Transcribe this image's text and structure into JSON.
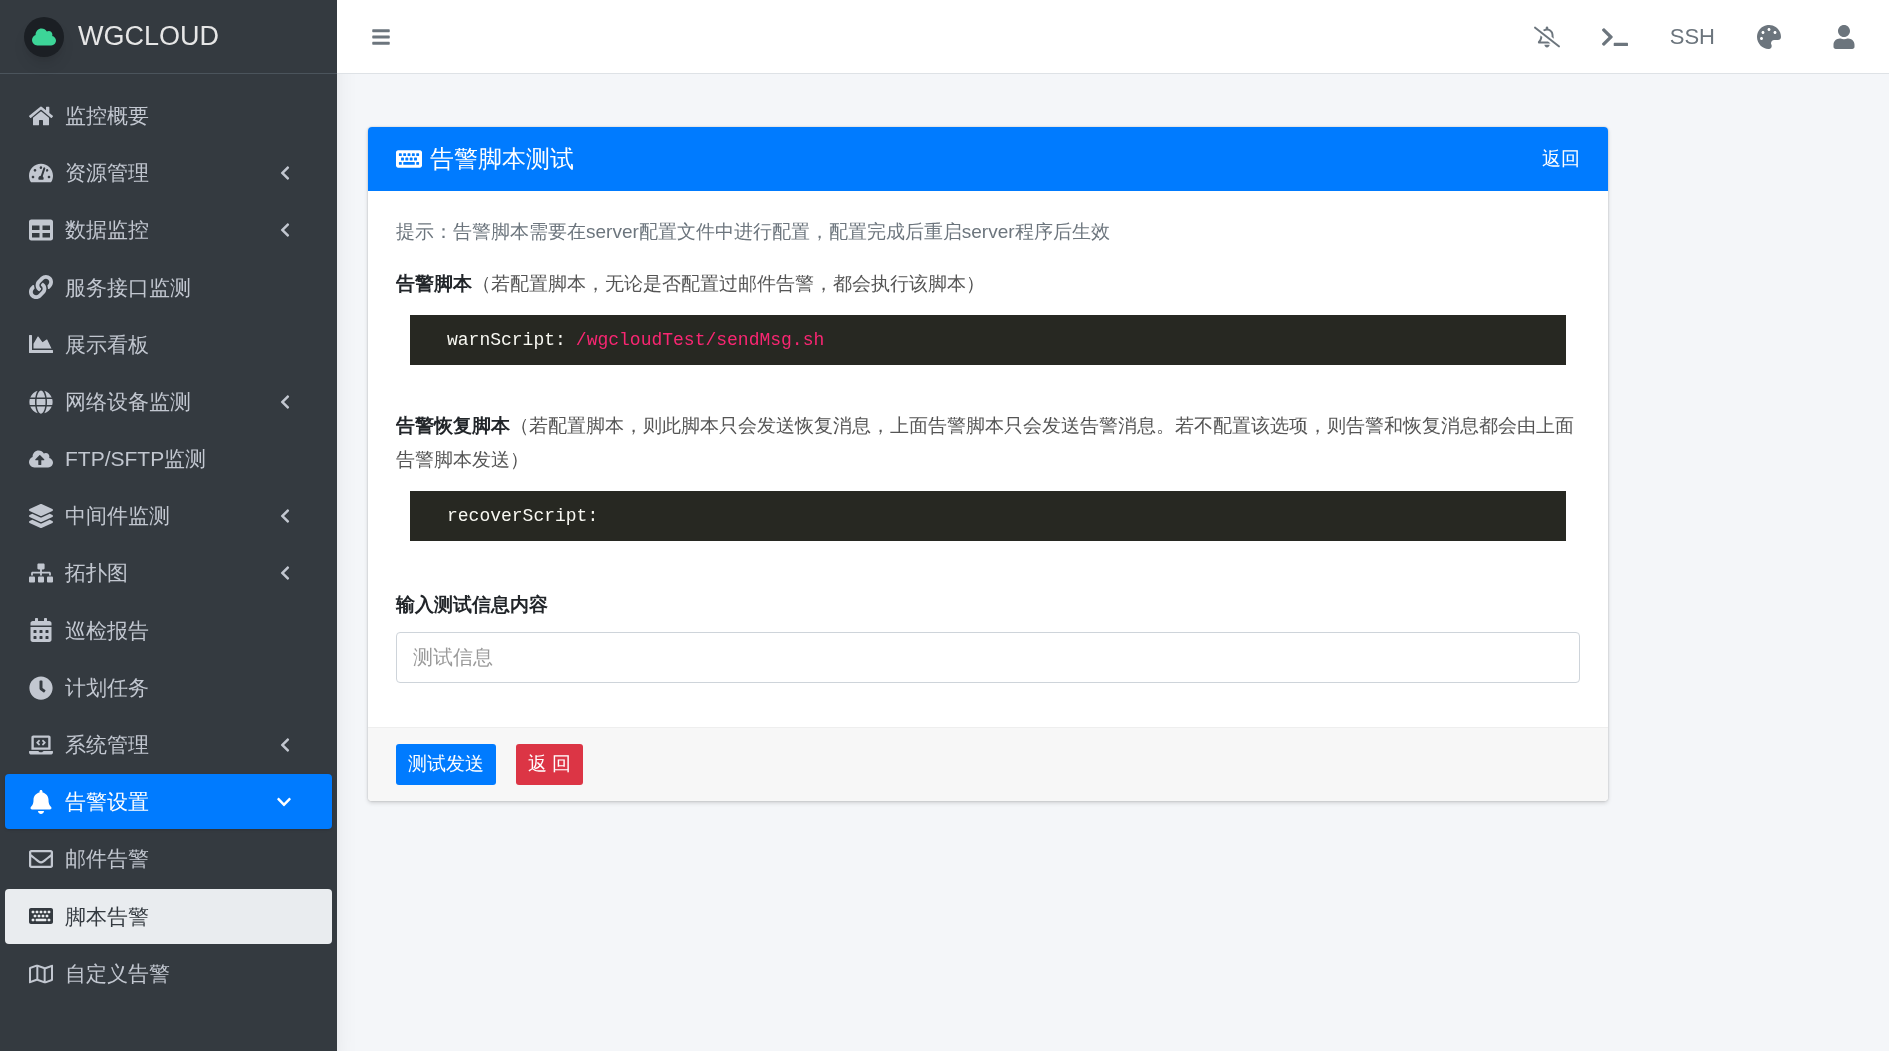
{
  "brand": {
    "name": "WGCLOUD"
  },
  "sidebar": {
    "items": [
      {
        "label": "监控概要",
        "selected": false
      },
      {
        "label": "资源管理",
        "selected": false,
        "expanded": false
      },
      {
        "label": "数据监控",
        "selected": false,
        "expanded": false
      },
      {
        "label": "服务接口监测",
        "selected": false
      },
      {
        "label": "展示看板",
        "selected": false
      },
      {
        "label": "网络设备监测",
        "selected": false,
        "expanded": false
      },
      {
        "label": "FTP/SFTP监测",
        "selected": false
      },
      {
        "label": "中间件监测",
        "selected": false,
        "expanded": false
      },
      {
        "label": "拓扑图",
        "selected": false,
        "expanded": false
      },
      {
        "label": "巡检报告",
        "selected": false
      },
      {
        "label": "计划任务",
        "selected": false
      },
      {
        "label": "系统管理",
        "selected": false,
        "expanded": false
      },
      {
        "label": "告警设置",
        "selected": true,
        "expanded": true,
        "children": [
          {
            "label": "邮件告警",
            "selected": false
          },
          {
            "label": "脚本告警",
            "selected": true
          },
          {
            "label": "自定义告警",
            "selected": false
          }
        ]
      }
    ]
  },
  "topbar": {
    "ssh": "SSH"
  },
  "card": {
    "title": "告警脚本测试",
    "back_link": "返回",
    "hint": "提示：告警脚本需要在server配置文件中进行配置，配置完成后重启server程序后生效",
    "sections": [
      {
        "label": "**告警脚本**（若配置脚本，无论是否配置过邮件告警，都会执行该脚本）",
        "code_key": "warnScript:",
        "code_value": "/wgcloudTest/sendMsg.sh"
      },
      {
        "label": "**告警恢复脚本**（若配置脚本，则此脚本只会发送恢复消息，上面告警脚本只会发送告警消息。若不配置该选项，则告警和恢复消息都会由上面告警脚本发送）",
        "code_key": "recoverScript:"
      }
    ],
    "input": {
      "label": "输入测试信息内容",
      "placeholder": "测试信息"
    },
    "buttons": [
      {
        "label": "测试发送",
        "kind": "primary"
      },
      {
        "label": "返 回",
        "kind": "danger"
      }
    ]
  }
}
